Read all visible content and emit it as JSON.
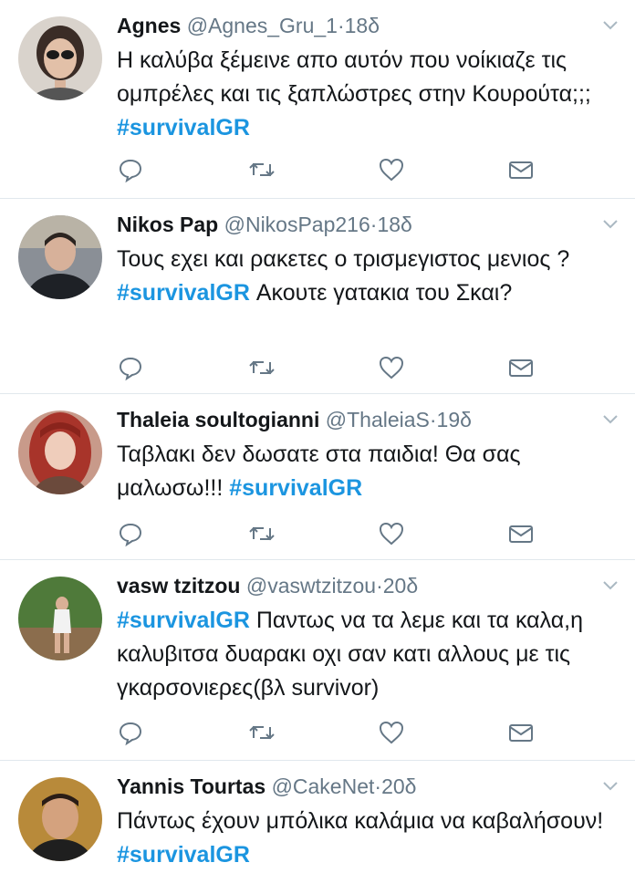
{
  "tweets": [
    {
      "name": "Agnes",
      "handle": "@Agnes_Gru_1",
      "time": "18δ",
      "text_before": "Η καλύβα ξέμεινε απο αυτόν που νοίκιαζε τις ομπρέλες και τις ξαπλώστρες στην Κουρούτα;;; ",
      "hashtag": "#survivalGR",
      "text_after": ""
    },
    {
      "name": "Nikos Pap",
      "handle": "@NikosPap216",
      "time": "18δ",
      "text_before": "Τους εχει και ρακετες ο τρισμεγιστος μενιος ? ",
      "hashtag": "#survivalGR",
      "text_after": " Ακουτε γατακια του Σκαι?"
    },
    {
      "name": "Thaleia soultogianni",
      "handle": "@ThaleiaS",
      "time": "19δ",
      "text_before": "Ταβλακι δεν δωσατε στα παιδια! Θα σας μαλωσω!!! ",
      "hashtag": "#survivalGR",
      "text_after": ""
    },
    {
      "name": "vasw tzitzou",
      "handle": "@vaswtzitzou",
      "time": "20δ",
      "text_before": "",
      "hashtag": "#survivalGR",
      "text_after": " Παντως να τα λεμε και τα καλα,η καλυβιτσα δυαρακι οχι σαν κατι αλλους με τις γκαρσονιερες(βλ survivor)"
    },
    {
      "name": "Yannis Tourtas",
      "handle": "@CakeNet",
      "time": "20δ",
      "text_before": "Πάντως έχουν μπόλικα καλάμια να καβαλήσουν! ",
      "hashtag": "#survivalGR",
      "text_after": ""
    }
  ],
  "separator": "·",
  "icons": [
    "reply-icon",
    "retweet-icon",
    "like-icon",
    "direct-message-icon",
    "chevron-down-icon"
  ],
  "colors": {
    "hashtag": "#1b95e0",
    "secondary": "#657786",
    "icon": "#657786",
    "divider": "#e1e8ed"
  }
}
